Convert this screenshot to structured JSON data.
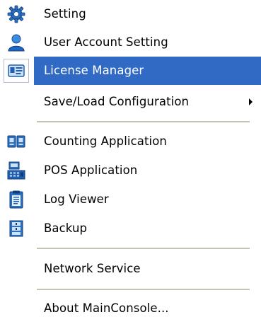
{
  "menu": {
    "items": [
      {
        "label": "Setting",
        "icon": "gear-icon"
      },
      {
        "label": "User Account Setting",
        "icon": "user-icon"
      },
      {
        "label": "License Manager",
        "icon": "license-card-icon",
        "selected": true
      },
      {
        "label": "Save/Load Configuration",
        "icon": null,
        "submenu": true
      },
      {
        "label": "Counting Application",
        "icon": "counting-icon"
      },
      {
        "label": "POS Application",
        "icon": "pos-terminal-icon"
      },
      {
        "label": "Log Viewer",
        "icon": "log-clipboard-icon"
      },
      {
        "label": "Backup",
        "icon": "backup-icon"
      },
      {
        "label": "Network Service",
        "icon": null
      },
      {
        "label": "About MainConsole...",
        "icon": null
      }
    ]
  },
  "colors": {
    "selection": "#316ac5",
    "separator": "#c5c2b2",
    "icon_blue": "#1f5fb4"
  }
}
